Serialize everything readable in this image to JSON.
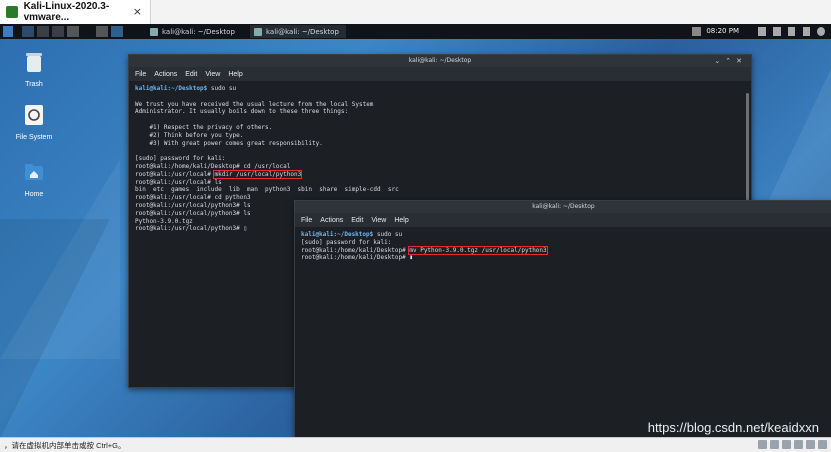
{
  "vm_tab": {
    "title": "Kali-Linux-2020.3-vmware...",
    "close": "×"
  },
  "panel": {
    "tasks": [
      "kali@kali: ~/Desktop",
      "kali@kali: ~/Desktop"
    ],
    "clock": "08:20 PM"
  },
  "desktop_icons": [
    {
      "label": "Trash",
      "icon": "trash-icon"
    },
    {
      "label": "File System",
      "icon": "filesystem-icon"
    },
    {
      "label": "Home",
      "icon": "home-folder-icon"
    }
  ],
  "term1": {
    "title": "kali@kali: ~/Desktop",
    "menu": [
      "File",
      "Actions",
      "Edit",
      "View",
      "Help"
    ],
    "lines": [
      {
        "p": "kali@kali:~/Desktop$",
        "c": " sudo su"
      },
      {
        "p": "",
        "c": ""
      },
      {
        "p": "",
        "c": "We trust you have received the usual lecture from the local System"
      },
      {
        "p": "",
        "c": "Administrator. It usually boils down to these three things:"
      },
      {
        "p": "",
        "c": ""
      },
      {
        "p": "",
        "c": "    #1) Respect the privacy of others."
      },
      {
        "p": "",
        "c": "    #2) Think before you type."
      },
      {
        "p": "",
        "c": "    #3) With great power comes great responsibility."
      },
      {
        "p": "",
        "c": ""
      },
      {
        "p": "",
        "c": "[sudo] password for kali:"
      },
      {
        "p": "",
        "c": "root@kali:/home/kali/Desktop# cd /usr/local"
      },
      {
        "p": "",
        "c": "root@kali:/usr/local# ",
        "h": "mkdir /usr/local/python3"
      },
      {
        "p": "",
        "c": "root@kali:/usr/local# ls"
      },
      {
        "p": "",
        "c": "bin  etc  games  include  lib  man  python3  sbin  share  simple-cdd  src"
      },
      {
        "p": "",
        "c": "root@kali:/usr/local# cd python3"
      },
      {
        "p": "",
        "c": "root@kali:/usr/local/python3# ls"
      },
      {
        "p": "",
        "c": "root@kali:/usr/local/python3# ls"
      },
      {
        "p": "",
        "c": "Python-3.9.0.tgz"
      },
      {
        "p": "",
        "c": "root@kali:/usr/local/python3# ▯"
      }
    ]
  },
  "term2": {
    "title": "kali@kali: ~/Desktop",
    "menu": [
      "File",
      "Actions",
      "Edit",
      "View",
      "Help"
    ],
    "lines": [
      {
        "p": "kali@kali:~/Desktop$",
        "c": " sudo su"
      },
      {
        "p": "",
        "c": "[sudo] password for kali:"
      },
      {
        "p": "",
        "c": "root@kali:/home/kali/Desktop# ",
        "h": "mv Python-3.9.0.tgz /usr/local/python3"
      },
      {
        "p": "",
        "c": "root@kali:/home/kali/Desktop# ▮"
      }
    ]
  },
  "statusbar": {
    "hint": "，请在虚拟机内部单击或按 Ctrl+G。"
  },
  "watermark": "https://blog.csdn.net/keaidxxn",
  "colors": {
    "highlight": "#e0302e",
    "prompt": "#6fb6f0"
  }
}
